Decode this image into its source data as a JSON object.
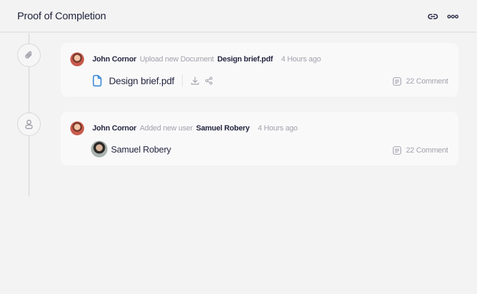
{
  "header": {
    "title": "Proof of Completion"
  },
  "timeline": [
    {
      "type": "document",
      "actor": "John Cornor",
      "verb": "Upload new Document",
      "object": "Design brief.pdf",
      "time": "4 Hours ago",
      "file_name": "Design brief.pdf",
      "comments": "22 Comment",
      "icon": "paperclip-icon"
    },
    {
      "type": "user",
      "actor": "John Cornor",
      "verb": "Added new user",
      "object": "Samuel Robery",
      "time": "4 Hours ago",
      "user_name": "Samuel Robery",
      "comments": "22 Comment",
      "icon": "user-icon"
    }
  ],
  "colors": {
    "background": "#f3f3f3",
    "card": "#f9f9fa",
    "text_primary": "#25263f",
    "text_muted": "#a1a1ab",
    "file_accent": "#2b7fd6"
  }
}
